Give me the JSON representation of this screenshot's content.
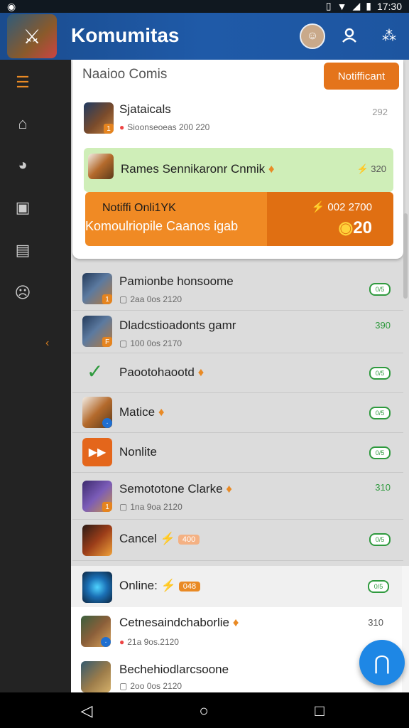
{
  "status": {
    "time": "17:30",
    "left_icon": "app-notification-icon"
  },
  "appbar": {
    "title": "Komumitas"
  },
  "card": {
    "heading": "Naaioo Comis",
    "notif_button": "Notifficant",
    "row1": {
      "title": "Sjataicals",
      "sub": "Sioonseoeas 200 220",
      "value": "292"
    },
    "green_strip": {
      "title": "Rames Sennikaronr Cnmik",
      "value": "320"
    },
    "banner": {
      "line1": "Notiffi Onli1YK",
      "line2": "Komoulriopile Caanos igab",
      "value1": "002 2700",
      "value2": "20"
    }
  },
  "list": [
    {
      "title": "Pamionbe honsoome",
      "sub": "2aa 0os 2120",
      "value": "0/5",
      "style": "pill"
    },
    {
      "title": "Dladcstioadonts gamr",
      "sub": "100 0os 2170",
      "value": "390",
      "style": "green"
    },
    {
      "title": "Paootohaootd",
      "sub": "",
      "value": "0/5",
      "style": "pill"
    },
    {
      "title": "Matice",
      "sub": "",
      "value": "0/5",
      "style": "pill"
    },
    {
      "title": "Nonlite",
      "sub": "",
      "value": "0/5",
      "style": "pill"
    },
    {
      "title": "Semototone Clarke",
      "sub": "1na 9oa 2120",
      "value": "310",
      "style": "green"
    },
    {
      "title": "Cancel",
      "badge": "400",
      "sub": "",
      "value": "0/5",
      "style": "pill"
    }
  ],
  "lower": [
    {
      "title": "Online:",
      "badge": "048",
      "sub": "",
      "value": "0/5",
      "style": "pill"
    },
    {
      "title": "Cetnesaindchaborlie",
      "sub": "21a 9os.2120",
      "value": "310",
      "style": "gray"
    },
    {
      "title": "Bechehiodlarcsoone",
      "sub": "2oo 0os 2120",
      "value": "",
      "style": "none"
    }
  ]
}
